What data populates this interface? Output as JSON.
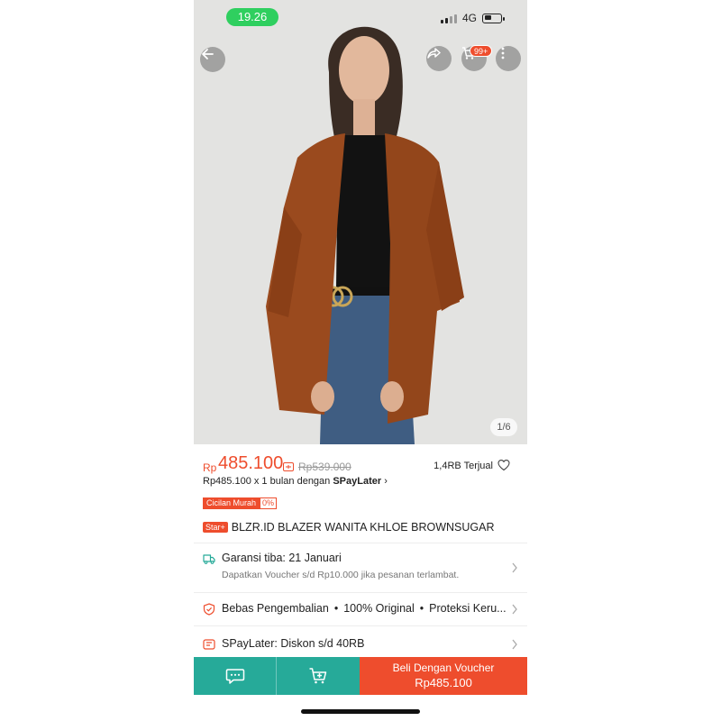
{
  "status_bar": {
    "time": "19.26",
    "network": "4G",
    "battery_level": 0.45,
    "signal_bars_active": 2,
    "signal_bars_total": 4
  },
  "top_nav": {
    "cart_badge": "99+"
  },
  "gallery": {
    "indicator": "1/6",
    "current_image": 1,
    "total_images": 6
  },
  "price": {
    "currency": "Rp",
    "current": "485.100",
    "original": "Rp539.000",
    "sold_text": "1,4RB Terjual"
  },
  "paylater": {
    "text": "Rp485.100 x 1 bulan dengan ",
    "brand": "SPayLater",
    "arrow": "›"
  },
  "cicilan": {
    "label": "Cicilan Murah",
    "rate": "0%"
  },
  "product": {
    "badge": "Star+",
    "title": "BLZR.ID BLAZER WANITA KHLOE BROWNSUGAR"
  },
  "guarantee": {
    "title": "Garansi tiba: 21 Januari",
    "subtitle": "Dapatkan Voucher s/d Rp10.000 jika pesanan terlambat."
  },
  "returns": {
    "item1": "Bebas Pengembalian",
    "item2": "100% Original",
    "item3": "Proteksi Keru...",
    "separator": "•"
  },
  "spaylater_promo": {
    "text": "SPayLater: Diskon s/d 40RB"
  },
  "bottom_bar": {
    "buy_label": "Beli Dengan Voucher",
    "buy_price": "Rp485.100"
  },
  "colors": {
    "accent": "#ee4d2d",
    "teal": "#26aa99",
    "status_green": "#2fcf5f"
  }
}
